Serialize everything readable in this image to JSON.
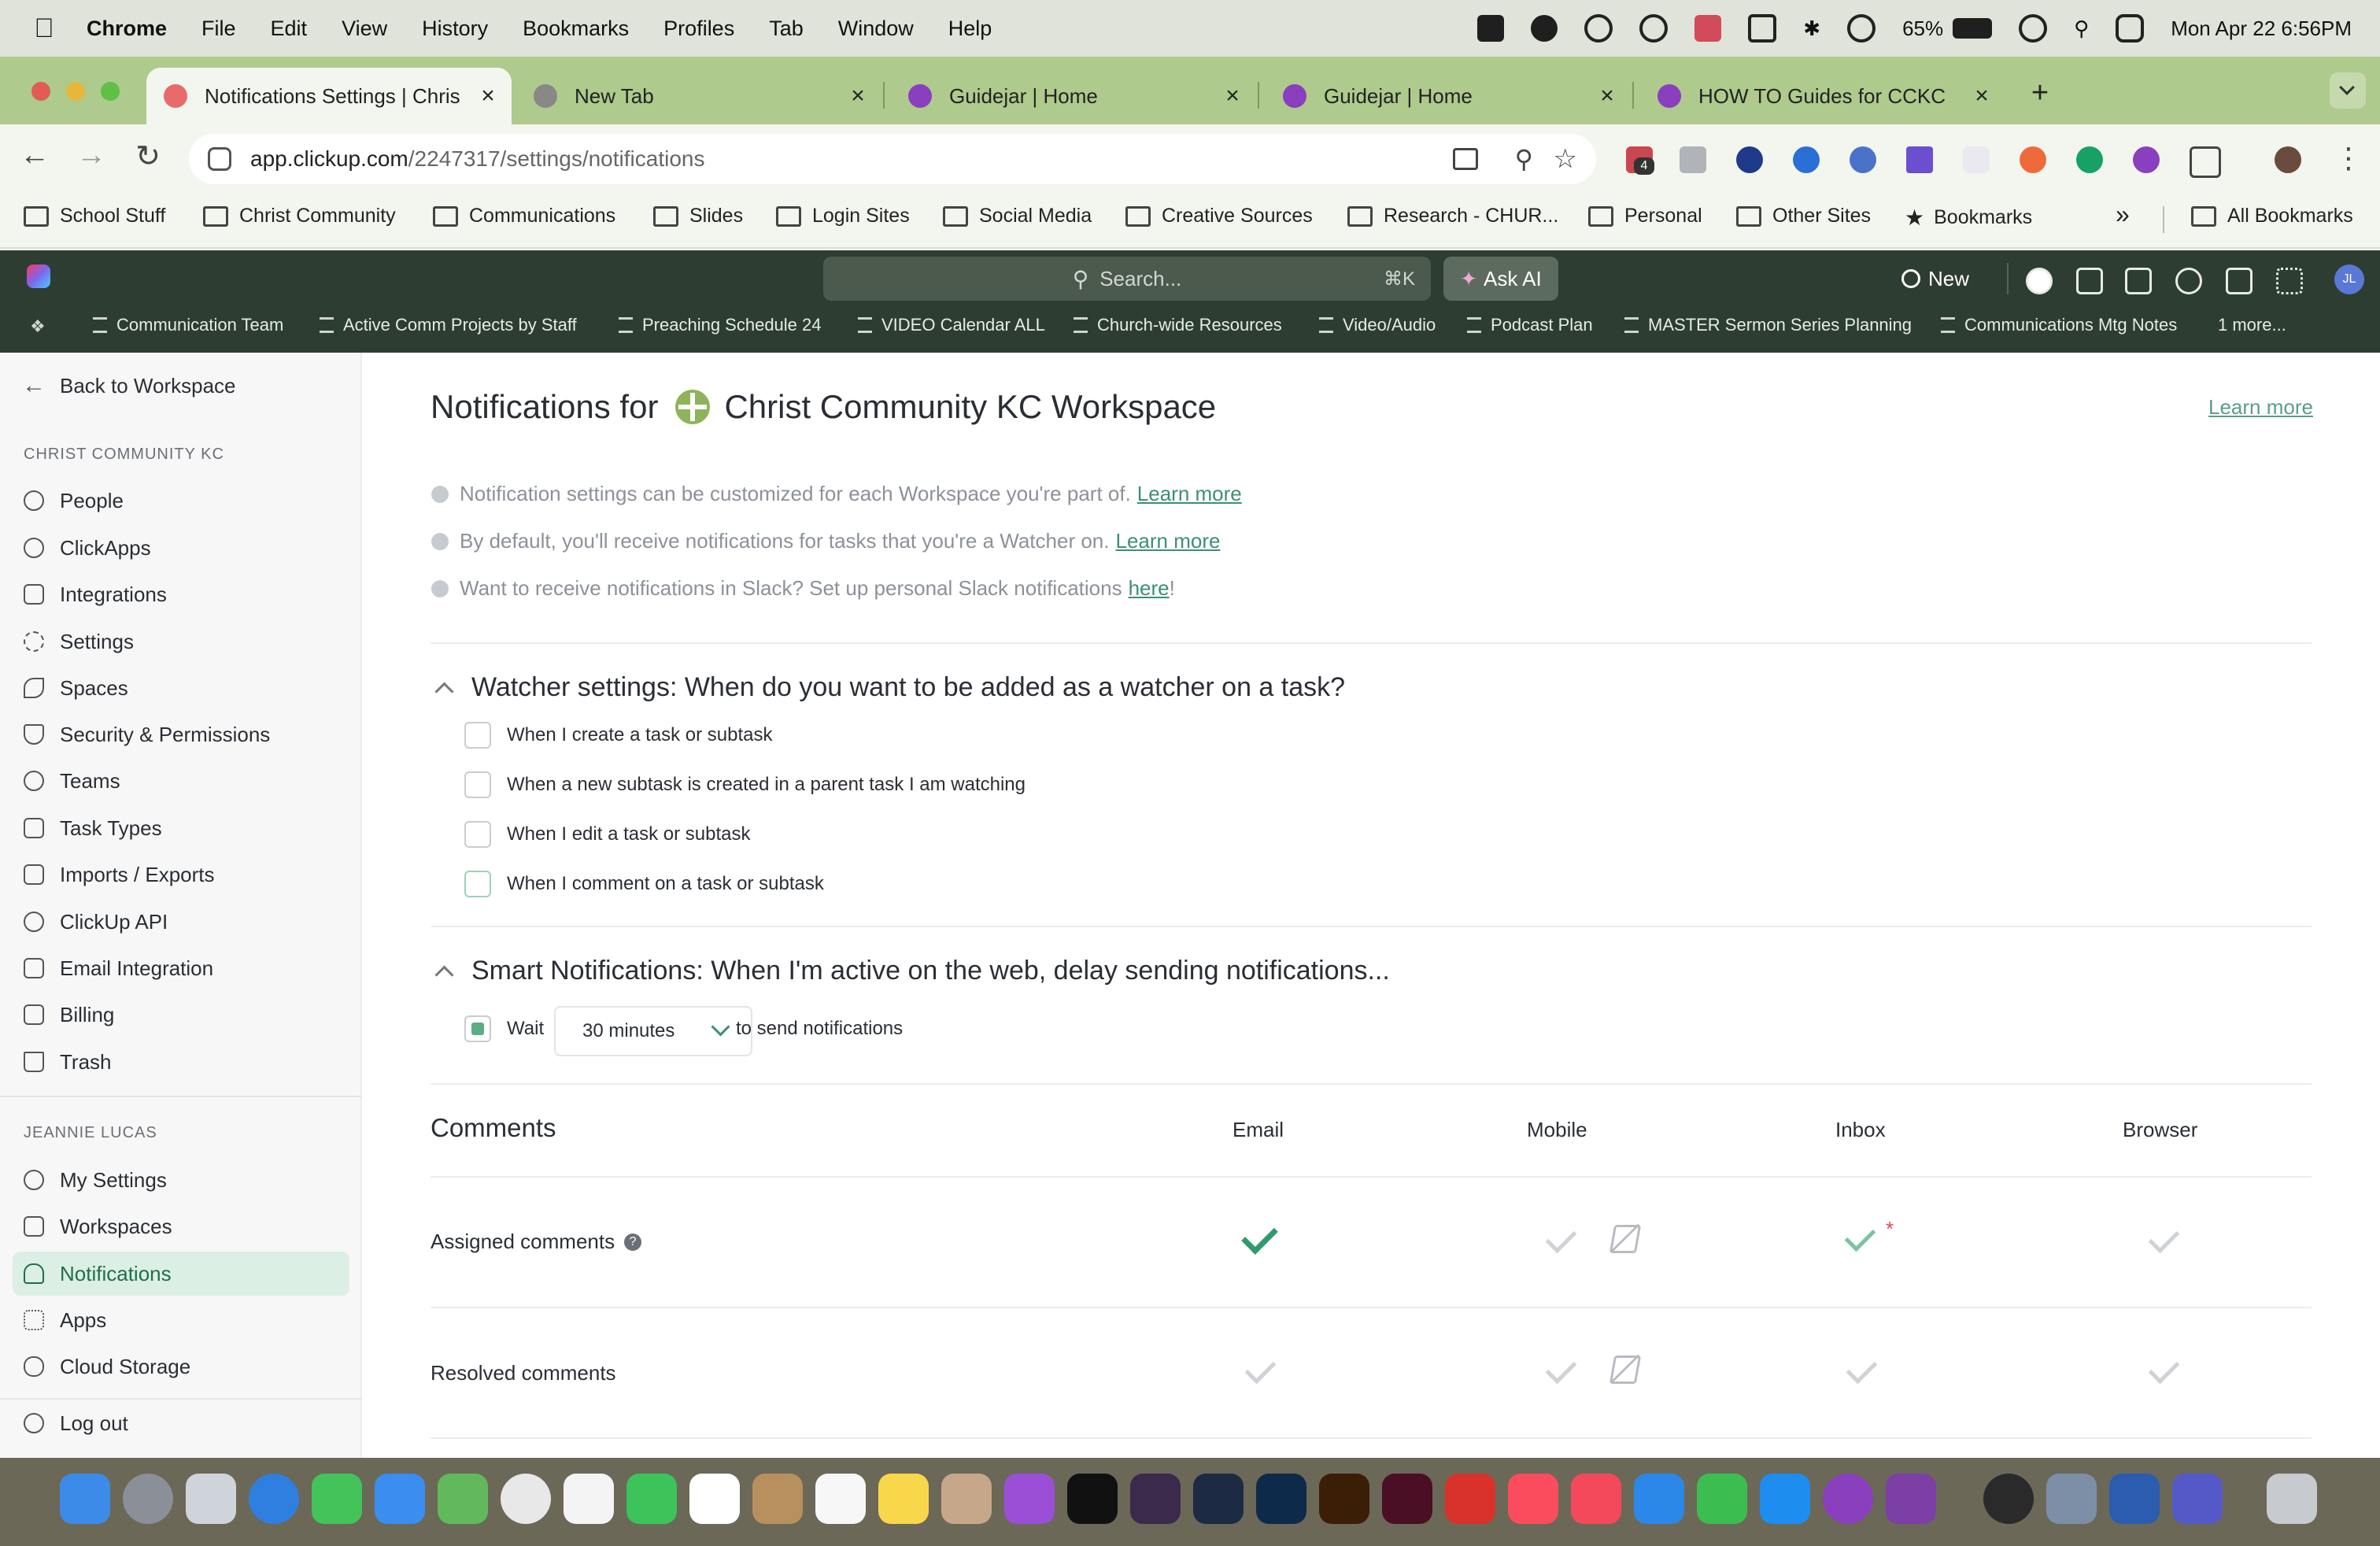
{
  "menubar": {
    "app": "Chrome",
    "items": [
      "File",
      "Edit",
      "View",
      "History",
      "Bookmarks",
      "Profiles",
      "Tab",
      "Window",
      "Help"
    ],
    "battery": "65%",
    "datetime": "Mon Apr 22  6:56PM"
  },
  "tabs": [
    {
      "title": "Notifications Settings | Chris",
      "active": true
    },
    {
      "title": "New Tab"
    },
    {
      "title": "Guidejar | Home"
    },
    {
      "title": "Guidejar | Home"
    },
    {
      "title": "HOW TO Guides for CCKC"
    }
  ],
  "tab_close": "×",
  "new_tab": "+",
  "address": {
    "host": "app.clickup.com",
    "path": "/2247317/settings/notifications"
  },
  "ext_badge": "4",
  "bookmarks": [
    "School Stuff",
    "Christ Community",
    "Communications",
    "Slides",
    "Login Sites",
    "Social Media",
    "Creative Sources",
    "Research - CHUR...",
    "Personal",
    "Other Sites",
    "Bookmarks"
  ],
  "bookmarks_more": "»",
  "bookmarks_all": "All Bookmarks",
  "clickup": {
    "search_placeholder": "Search...",
    "search_shortcut": "⌘K",
    "ask_ai": "Ask AI",
    "new_label": "New",
    "avatar": "JL",
    "favorites": [
      "Communication Team",
      "Active Comm Projects by Staff",
      "Preaching Schedule 24",
      "VIDEO Calendar ALL",
      "Church-wide Resources",
      "Video/Audio",
      "Podcast Plan",
      "MASTER Sermon Series Planning",
      "Communications Mtg Notes",
      "1 more..."
    ]
  },
  "sidebar": {
    "back": "Back to Workspace",
    "workspace_header": "CHRIST COMMUNITY KC",
    "workspace_items": [
      "People",
      "ClickApps",
      "Integrations",
      "Settings",
      "Spaces",
      "Security & Permissions",
      "Teams",
      "Task Types",
      "Imports / Exports",
      "ClickUp API",
      "Email Integration",
      "Billing",
      "Trash"
    ],
    "user_header": "JEANNIE LUCAS",
    "user_items": [
      "My Settings",
      "Workspaces",
      "Notifications",
      "Apps",
      "Cloud Storage"
    ],
    "logout": "Log out"
  },
  "main": {
    "title_prefix": "Notifications for",
    "title_workspace": "Christ Community KC Workspace",
    "learn_more": "Learn more",
    "notes": [
      {
        "text": "Notification settings can be customized for each Workspace you're part of.",
        "link": "Learn more",
        "tail": ""
      },
      {
        "text": "By default, you'll receive notifications for tasks that you're a Watcher on.",
        "link": "Learn more",
        "tail": ""
      },
      {
        "text": "Want to receive notifications in Slack? Set up personal Slack notifications",
        "link": "here",
        "tail": "!"
      }
    ],
    "watcher_title": "Watcher settings: When do you want to be added as a watcher on a task?",
    "watcher_options": [
      {
        "label": "When I create a task or subtask",
        "checked": false
      },
      {
        "label": "When a new subtask is created in a parent task I am watching",
        "checked": false
      },
      {
        "label": "When I edit a task or subtask",
        "checked": false
      },
      {
        "label": "When I comment on a task or subtask",
        "checked": false
      }
    ],
    "smart_title": "Smart Notifications: When I'm active on the web, delay sending notifications...",
    "smart": {
      "wait_label": "Wait",
      "delay": "30 minutes",
      "suffix": "to send notifications",
      "checked": true
    },
    "comments_title": "Comments",
    "columns": [
      "Email",
      "Mobile",
      "Inbox",
      "Browser"
    ],
    "rows": [
      {
        "label": "Assigned comments",
        "help": "?",
        "email": true,
        "mobile": false,
        "inbox": true,
        "browser": false
      },
      {
        "label": "Resolved comments",
        "help": "",
        "email": false,
        "mobile": false,
        "inbox": false,
        "browser": false
      }
    ],
    "required_mark": "*"
  },
  "colors": {
    "accent": "#2f9a6c",
    "tabstrip": "#aeca8c",
    "clickup_bar": "#2e3d31"
  }
}
